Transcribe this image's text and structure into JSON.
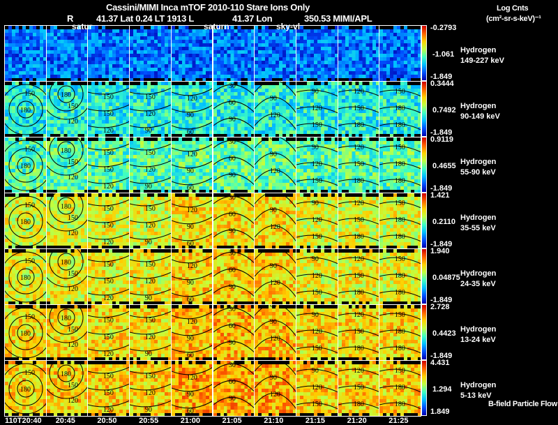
{
  "header": {
    "title": "Cassini/MIMI Inca mTOF  2010-110   Stare   Ions Only",
    "subtitle_r": "R",
    "subtitle": "41.37 Lat 0.24 LT 1913 L",
    "subtitle_l": "41.37 Lon",
    "subtitle_lon": "350.53  MIMI/APL"
  },
  "colorbar_title": {
    "line1": "Log Cnts",
    "line2": "(cm²-sr-s-keV)⁻¹"
  },
  "overlay_labels": [
    "satur",
    "saturn",
    "sky-vl"
  ],
  "footer_note": "B-field Particle Flow",
  "chart_data": {
    "type": "heatmap",
    "description_kind": "energetic neutral atom image grid",
    "x_tick_labels": [
      "110T20:40",
      "20:45",
      "20:50",
      "20:55",
      "21:00",
      "21:05",
      "21:10",
      "21:15",
      "21:20",
      "21:25"
    ],
    "contour_levels": [
      30,
      60,
      90,
      120,
      150,
      180
    ],
    "colormap": [
      "#0000b0",
      "#0050ff",
      "#00c0ff",
      "#40ffc0",
      "#c0ff40",
      "#ffd000",
      "#ff6000",
      "#d00000"
    ],
    "rows": [
      {
        "species": "Hydrogen",
        "energy": "149-227 keV",
        "cbar_max": "-0.2793",
        "cbar_mid": "-1.061",
        "cbar_min": "-1.849"
      },
      {
        "species": "Hydrogen",
        "energy": "90-149 keV",
        "cbar_max": "0.3444",
        "cbar_mid": "0.7492",
        "cbar_min": "-1.849"
      },
      {
        "species": "Hydrogen",
        "energy": "55-90 keV",
        "cbar_max": "0.9119",
        "cbar_mid": "0.4655",
        "cbar_min": "-1.849"
      },
      {
        "species": "Hydrogen",
        "energy": "35-55 keV",
        "cbar_max": "1.421",
        "cbar_mid": "0.2110",
        "cbar_min": "-1.849"
      },
      {
        "species": "Hydrogen",
        "energy": "24-35 keV",
        "cbar_max": "1.940",
        "cbar_mid": "0.04875",
        "cbar_min": "-1.849"
      },
      {
        "species": "Hydrogen",
        "energy": "13-24 keV",
        "cbar_max": "2.728",
        "cbar_mid": "0.4423",
        "cbar_min": "-1.849"
      },
      {
        "species": "Hydrogen",
        "energy": "5-13 keV",
        "cbar_max": "4.431",
        "cbar_mid": "1.294",
        "cbar_min": "1.849"
      }
    ]
  }
}
